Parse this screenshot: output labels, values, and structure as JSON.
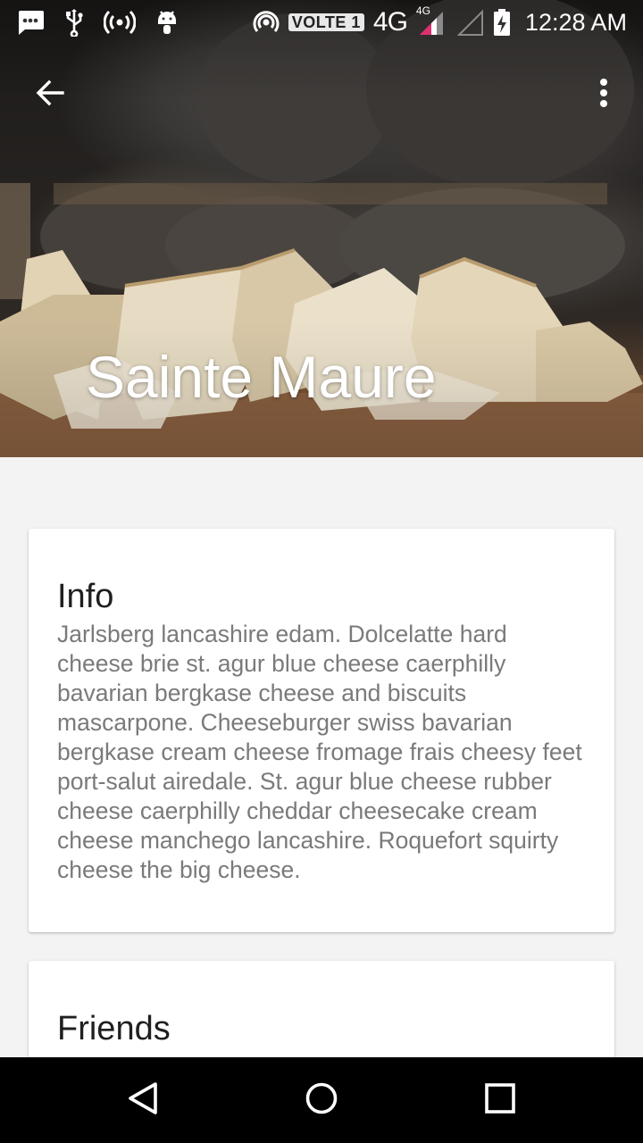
{
  "status_bar": {
    "volte_label": "VOLTE 1",
    "network_label": "4G",
    "network_small_label": "4G",
    "time": "12:28 AM",
    "icons": [
      "message-icon",
      "usb-icon",
      "hotspot-icon",
      "android-debug-icon",
      "nfc-cast-icon",
      "signal-icon",
      "signal-empty-icon",
      "battery-charging-icon"
    ]
  },
  "toolbar": {
    "back_icon": "arrow-back-icon",
    "more_icon": "more-vert-icon"
  },
  "header": {
    "title": "Sainte Maure"
  },
  "info_card": {
    "title": "Info",
    "body": "Jarlsberg lancashire edam. Dolcelatte hard cheese brie st. agur blue cheese caerphilly bavarian bergkase cheese and biscuits mascarpone. Cheeseburger swiss bavarian bergkase cream cheese fromage frais cheesy feet port-salut airedale. St. agur blue cheese rubber cheese caerphilly cheddar cheesecake cream cheese manchego lancashire. Roquefort squirty cheese the big cheese."
  },
  "friends_card": {
    "title": "Friends"
  },
  "nav_bar": {
    "icons": [
      "nav-back-icon",
      "nav-home-icon",
      "nav-recents-icon"
    ]
  }
}
